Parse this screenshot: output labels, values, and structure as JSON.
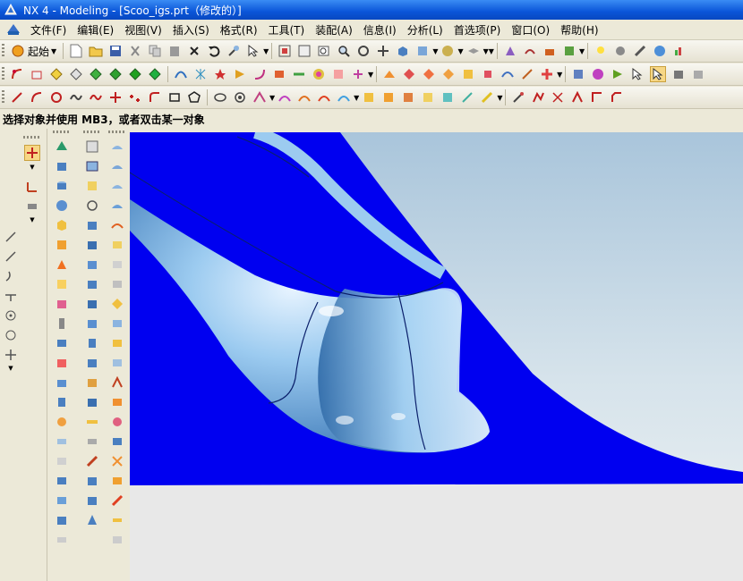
{
  "window": {
    "title": "NX 4 - Modeling - [Scoo_igs.prt（修改的）]"
  },
  "menu": {
    "items": [
      "文件(F)",
      "编辑(E)",
      "视图(V)",
      "插入(S)",
      "格式(R)",
      "工具(T)",
      "装配(A)",
      "信息(I)",
      "分析(L)",
      "首选项(P)",
      "窗口(O)",
      "帮助(H)"
    ]
  },
  "toolbar": {
    "start_label": "起始"
  },
  "status": {
    "prompt": "选择对象并使用 MB3，或者双击某一对象"
  },
  "colors": {
    "surface_blue": "#0000f0",
    "part_light_blue": "#9ccbf0",
    "titlebar": "#0a55d8",
    "background_top": "#b7cfe0",
    "background_bottom": "#eef2f3"
  }
}
